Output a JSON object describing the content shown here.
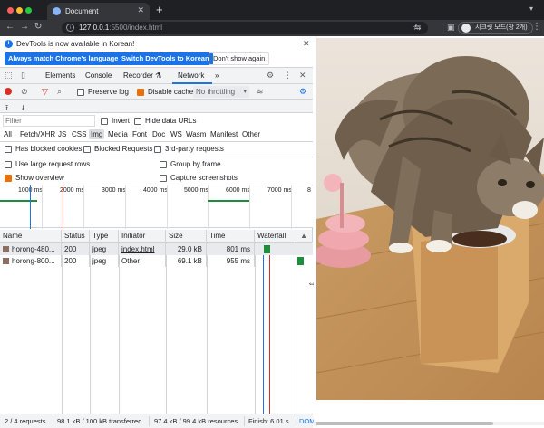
{
  "browser": {
    "tab_title": "Document",
    "url_host": "127.0.0.1",
    "url_path": ":5500/index.html",
    "profile_label": "시크릿 모드(창 2개)"
  },
  "infobar": {
    "message": "DevTools is now available in Korean!",
    "btn_match": "Always match Chrome's language",
    "btn_switch": "Switch DevTools to Korean",
    "btn_dont_show": "Don't show again"
  },
  "devtools_tabs": {
    "elements": "Elements",
    "console": "Console",
    "recorder": "Recorder",
    "network": "Network",
    "more": "»"
  },
  "toolbar": {
    "preserve_log": "Preserve log",
    "disable_cache": "Disable cache",
    "throttling": "No throttling"
  },
  "filter": {
    "placeholder": "Filter",
    "invert": "Invert",
    "hide_data_urls": "Hide data URLs"
  },
  "types": [
    "All",
    "Fetch/XHR",
    "JS",
    "CSS",
    "Img",
    "Media",
    "Font",
    "Doc",
    "WS",
    "Wasm",
    "Manifest",
    "Other"
  ],
  "options": {
    "has_blocked_cookies": "Has blocked cookies",
    "blocked_requests": "Blocked Requests",
    "third_party": "3rd-party requests",
    "large_rows": "Use large request rows",
    "group_by_frame": "Group by frame",
    "show_overview": "Show overview",
    "capture_screenshots": "Capture screenshots"
  },
  "overview": {
    "ticks": [
      "1000 ms",
      "2000 ms",
      "3000 ms",
      "4000 ms",
      "5000 ms",
      "6000 ms",
      "7000 ms",
      "8"
    ]
  },
  "table": {
    "headers": {
      "name": "Name",
      "status": "Status",
      "type": "Type",
      "initiator": "Initiator",
      "size": "Size",
      "time": "Time",
      "waterfall": "Waterfall",
      "sort_arrow": "▲"
    },
    "rows": [
      {
        "name": "horong-480...",
        "status": "200",
        "type": "jpeg",
        "initiator": "index.html",
        "size": "29.0 kB",
        "time": "801 ms"
      },
      {
        "name": "horong-800...",
        "status": "200",
        "type": "jpeg",
        "initiator": "Other",
        "size": "69.1 kB",
        "time": "955 ms"
      }
    ]
  },
  "status": {
    "requests": "2 / 4 requests",
    "transferred": "98.1 kB / 100 kB transferred",
    "resources": "97.4 kB / 99.4 kB resources",
    "finish": "Finish: 6.01 s",
    "dom": "DOM"
  },
  "colors": {
    "accent": "#1a73e8",
    "record": "#d93025",
    "checkbox_checked": "#e8710a",
    "waterfall_bar": "#1e8e3e"
  }
}
